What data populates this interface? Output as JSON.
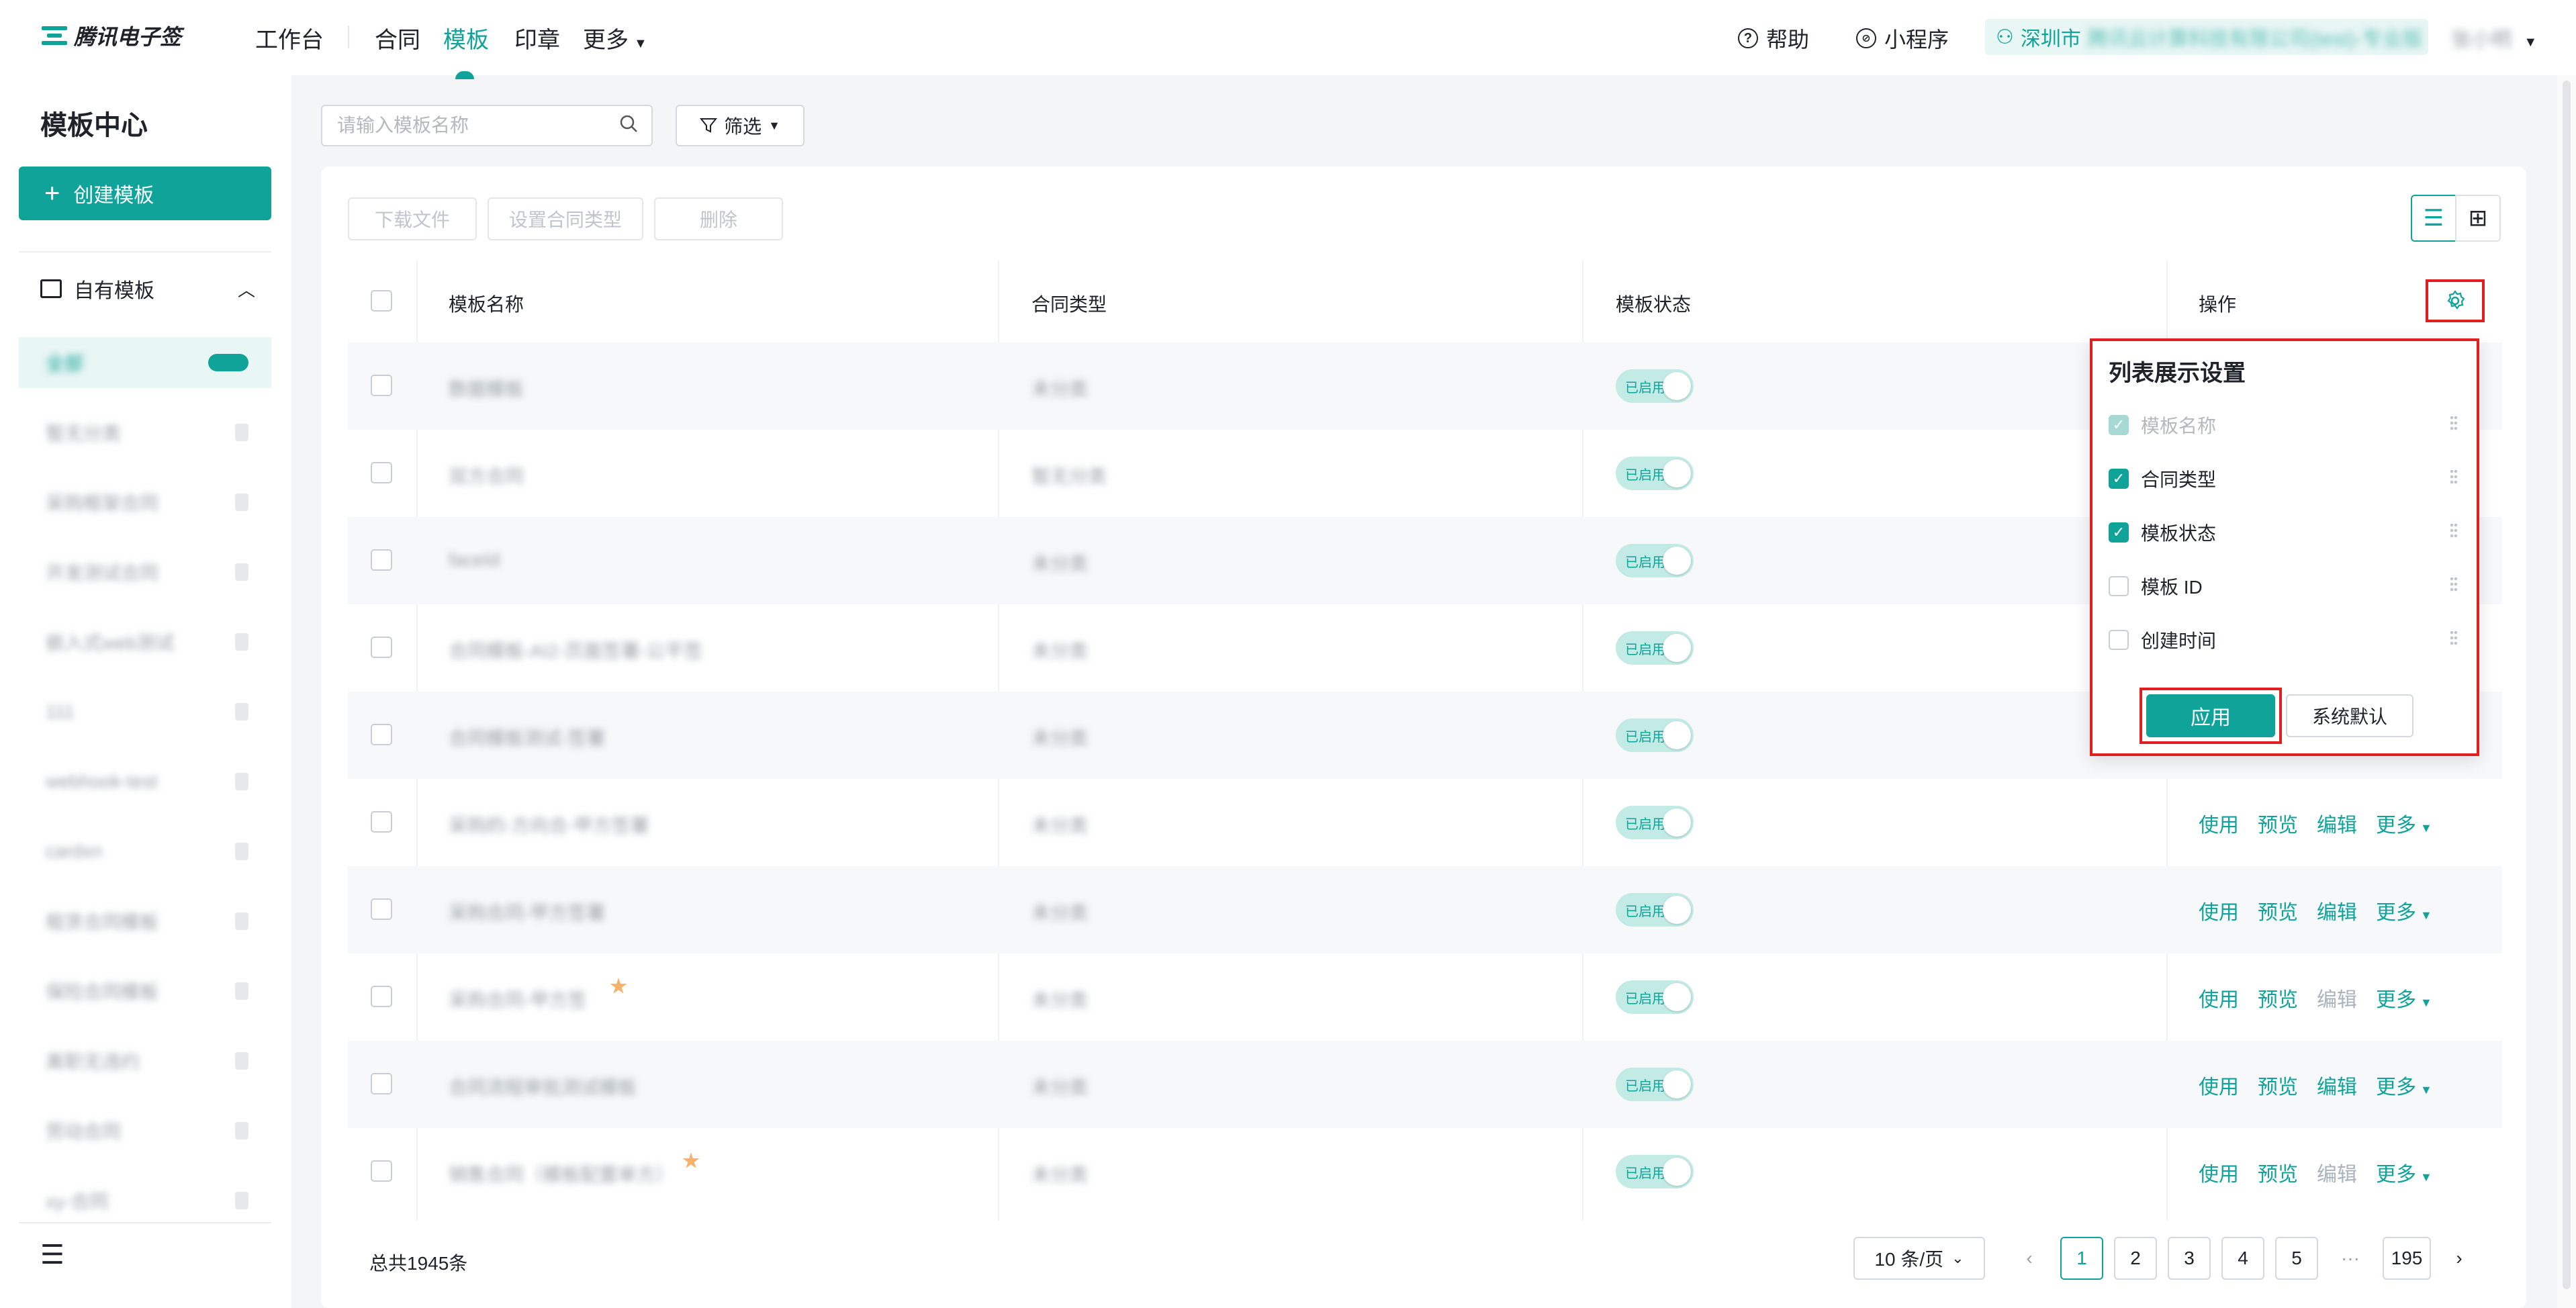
{
  "app": {
    "logo_text": "腾讯电子签",
    "brand_color": "#0fa39a"
  },
  "topnav": {
    "workbench": "工作台",
    "contract": "合同",
    "template": "模板",
    "seal": "印章",
    "more": "更多",
    "help": "帮助",
    "miniprogram": "小程序",
    "company_prefix": "深圳市",
    "company_rest": "腾讯云计算科技有限公司(test)-专业版",
    "user_name": "张小明"
  },
  "sidebar": {
    "title": "模板中心",
    "create_button": "创建模板",
    "group_label": "自有模板",
    "items": [
      {
        "label": "全部"
      },
      {
        "label": "暂无分类"
      },
      {
        "label": "采购框架合同"
      },
      {
        "label": "开发测试合同"
      },
      {
        "label": "嵌入式web测试"
      },
      {
        "label": "111"
      },
      {
        "label": "webhook-test"
      },
      {
        "label": "cardxn"
      },
      {
        "label": "租赁合同模板"
      },
      {
        "label": "保险合同模板"
      },
      {
        "label": "离职无违约"
      },
      {
        "label": "劳动合同"
      },
      {
        "label": "xy-合同"
      }
    ]
  },
  "toolbar": {
    "search_placeholder": "请输入模板名称",
    "filter_label": "筛选",
    "download_label": "下载文件",
    "set_type_label": "设置合同类型",
    "delete_label": "删除"
  },
  "table": {
    "headers": {
      "name": "模板名称",
      "type": "合同类型",
      "status": "模板状态",
      "actions": "操作"
    },
    "status_text": "已启用",
    "action_labels": {
      "use": "使用",
      "preview": "预览",
      "edit": "编辑",
      "more": "更多"
    },
    "rows": [
      {
        "name": "数据模板",
        "type": "未分类"
      },
      {
        "name": "双方合同",
        "type": "暂无分类"
      },
      {
        "name": "faceId",
        "type": "未分类"
      },
      {
        "name": "合同模板-AI2-页面签署-公平签",
        "type": "未分类"
      },
      {
        "name": "合同模板测试-签署",
        "type": "未分类"
      },
      {
        "name": "采购的-方向合-甲方签署",
        "type": "未分类"
      },
      {
        "name": "采购合同-甲方签署",
        "type": "未分类"
      },
      {
        "name": "采购合同-甲方签",
        "type": "未分类"
      },
      {
        "name": "合同流程审批测试模板",
        "type": "未分类"
      },
      {
        "name": "销售合同（模板配置单方）",
        "type": "未分类"
      }
    ]
  },
  "popup": {
    "title": "列表展示设置",
    "options": [
      {
        "label": "模板名称",
        "checked": true,
        "disabled": true
      },
      {
        "label": "合同类型",
        "checked": true,
        "disabled": false
      },
      {
        "label": "模板状态",
        "checked": true,
        "disabled": false
      },
      {
        "label": "模板 ID",
        "checked": false,
        "disabled": false
      },
      {
        "label": "创建时间",
        "checked": false,
        "disabled": false
      }
    ],
    "apply_label": "应用",
    "default_label": "系统默认"
  },
  "footer": {
    "total": "总共1945条",
    "page_size": "10 条/页",
    "pages": [
      "1",
      "2",
      "3",
      "4",
      "5"
    ],
    "ellipsis": "···",
    "last_page": "195"
  }
}
